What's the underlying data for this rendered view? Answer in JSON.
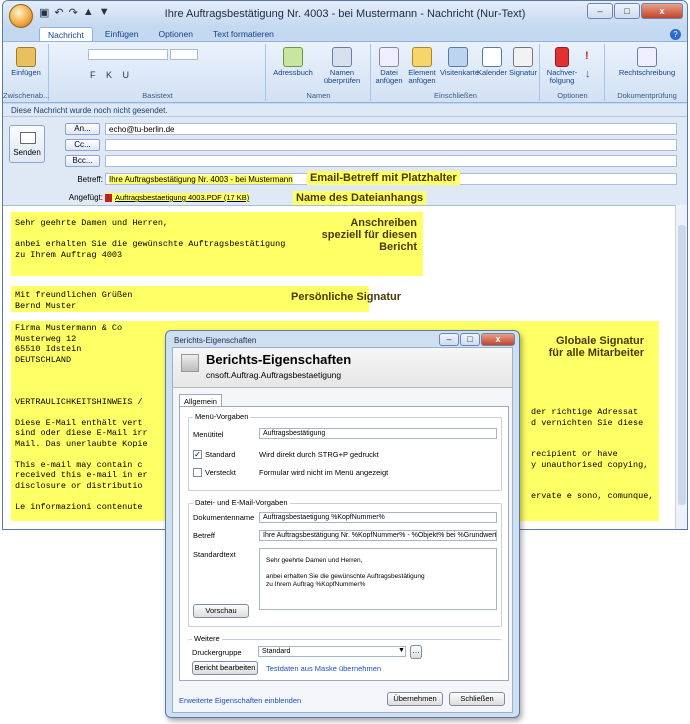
{
  "window": {
    "title": "Ihre Auftragsbestätigung Nr. 4003 - bei Mustermann - Nachricht (Nur-Text)",
    "controls": [
      "–",
      "□",
      "x"
    ]
  },
  "tabs": [
    "Nachricht",
    "Einfügen",
    "Optionen",
    "Text formatieren"
  ],
  "ribbon": {
    "einfuegen": "Einfügen",
    "zwischenablage": "Zwischenab...",
    "basistext": "Basistext",
    "adressbuch": "Adressbuch",
    "namen_ueberpruefen": "Namen überprüfen",
    "namen": "Namen",
    "datei_anfuegen": "Datei anfügen",
    "element_anfuegen": "Element anfügen",
    "visitenkarte": "Visitenkarte",
    "kalender": "Kalender",
    "signatur": "Signatur",
    "einschliessen": "Einschließen",
    "nachverfolgung": "Nachver-folgung",
    "optionen": "Optionen",
    "rechtschreibung": "Rechtschreibung",
    "dokumentpruefung": "Dokumentprüfung"
  },
  "info_bar": "Diese Nachricht wurde noch nicht gesendet.",
  "header": {
    "send": "Senden",
    "an_btn": "An...",
    "an_val": "echo@tu-berlin.de",
    "cc_btn": "Cc...",
    "bcc_btn": "Bcc...",
    "betreff_label": "Betreff:",
    "betreff_val": "Ihre Auftragsbestätigung Nr. 4003 - bei Mustermann",
    "angefuegt_label": "Angefügt:",
    "angefuegt_val": "Auftragsbestaetigung 4003.PDF (17 KB)"
  },
  "annotations": {
    "betreff": "Email-Betreff mit Platzhalter",
    "dateiname": "Name des Dateianhangs",
    "anschreiben": "Anschreiben speziell für diesen Bericht",
    "signatur": "Persönliche Signatur",
    "global": "Globale Signatur für alle Mitarbeiter"
  },
  "body": {
    "anschreiben": "Sehr geehrte Damen und Herren,\n\nanbei erhalten Sie die gewünschte Auftragsbestätigung\nzu Ihrem Auftrag 4003",
    "signatur": "Mit freundlichen Grüßen\nBernd Muster",
    "firma": "Firma Mustermann & Co\nMusterweg 12\n65510 Idstein\nDEUTSCHLAND\n\n\n\nVERTRAULICHKEITSHINWEIS /\n\nDiese E-Mail enthält vert\nsind oder diese E-Mail irr\nMail. Das unerlaubte Kopie\n\nThis e-mail may contain c\nreceived this e-mail in er\ndisclosure or distributio\n\nLe informazioni contenute",
    "right_tail": "der richtige Adressat\nd vernichten Sie diese\n\n\nrecipient or have\ny unauthorised copying,\n\n\nervate e sono, comunque,"
  },
  "dialog": {
    "title": "Berichts-Eigenschaften",
    "heading": "Berichts-Eigenschaften",
    "subheading": "cnsoft.Auftrag.Auftragsbestaetigung",
    "tab": "Allgemein",
    "menu_group": "Menü-Vorgaben",
    "menutitel_label": "Menütitel",
    "menutitel_val": "Auftragsbestätigung",
    "standard_label": "Standard",
    "standard_desc": "Wird direkt durch STRG+P gedruckt",
    "versteckt_label": "Versteckt",
    "versteckt_desc": "Formular wird nicht im Menü angezeigt",
    "file_group": "Datei- und E-Mail-Vorgaben",
    "dokname_label": "Dokumentenname",
    "dokname_val": "Auftragsbestaetigung %KopfNummer%",
    "betreff_label": "Betreff",
    "betreff_val": "Ihre Auftragsbestätigung Nr. %KopfNummer% - %Objekt% bei %Grundwerte.Fir",
    "standardtext_label": "Standardtext",
    "standardtext_val": "Sehr geehrte Damen und Herren,\n\nanbei erhalten Sie die gewünschte Auftragsbestätigung\nzu Ihrem Auftrag %KopfNummer%",
    "vorschau": "Vorschau",
    "weitere_group": "Weitere",
    "druckergruppe_label": "Druckergruppe",
    "druckergruppe_val": "Standard",
    "bericht_bearbeiten": "Bericht bearbeiten",
    "testdaten": "Testdaten aus Maske übernehmen",
    "erweiterte": "Erweiterte Eigenschaften einblenden",
    "uebernehmen": "Übernehmen",
    "schliessen": "Schließen"
  }
}
